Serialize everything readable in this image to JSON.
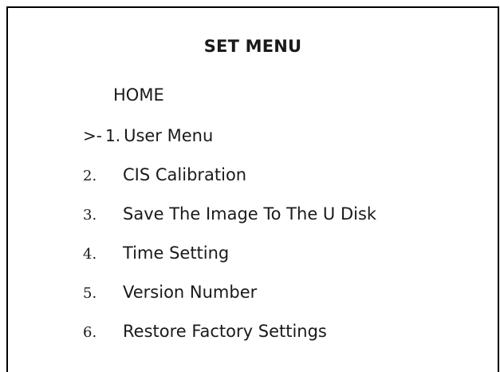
{
  "menu": {
    "title": "SET MENU",
    "home": "HOME",
    "cursor": ">-",
    "selected_number": "1.",
    "selected_label": "User Menu",
    "items": [
      {
        "number": "2.",
        "label": "CIS Calibration"
      },
      {
        "number": "3.",
        "label": "Save The Image To The U Disk"
      },
      {
        "number": "4.",
        "label": "Time Setting"
      },
      {
        "number": "5.",
        "label": "Version Number"
      },
      {
        "number": "6.",
        "label": "Restore Factory Settings"
      }
    ]
  }
}
